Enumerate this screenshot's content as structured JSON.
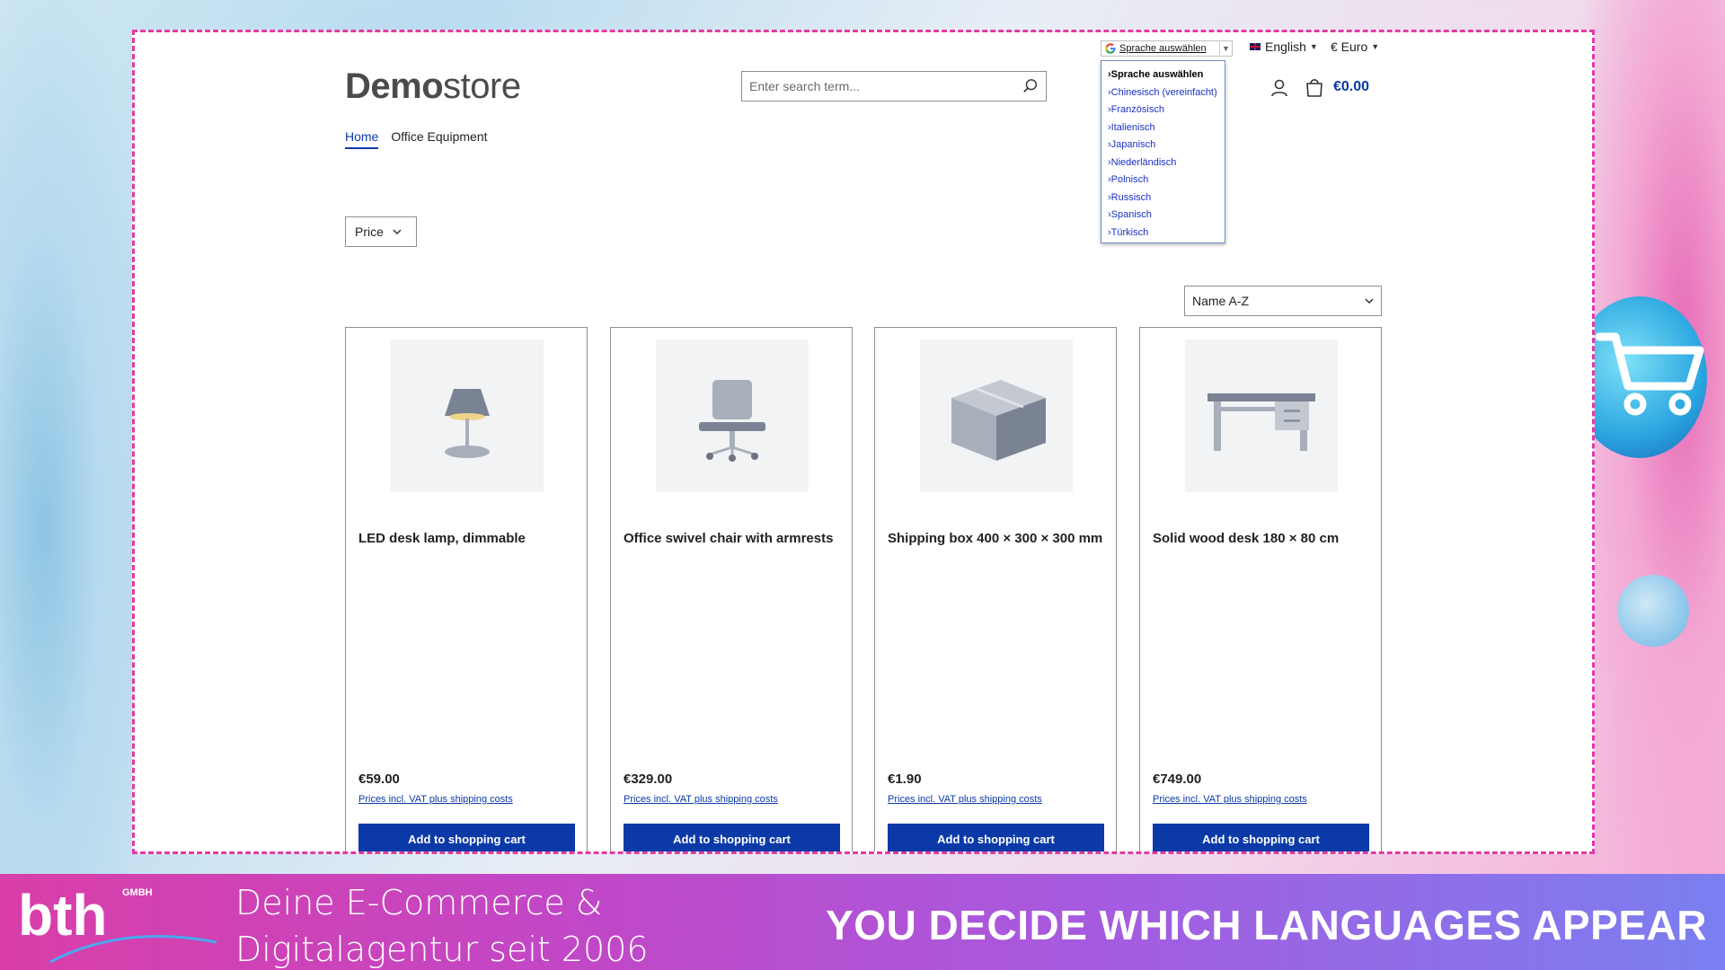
{
  "store": {
    "logo_bold": "Demo",
    "logo_light": "store",
    "search_placeholder": "Enter search term...",
    "language": "English",
    "currency": "€ Euro",
    "cart_total": "€0.00"
  },
  "translate": {
    "label": "Sprache auswählen",
    "options": [
      "›Sprache auswählen",
      "›Chinesisch (vereinfacht)",
      "›Französisch",
      "›Italienisch",
      "›Japanisch",
      "›Niederländisch",
      "›Polnisch",
      "›Russisch",
      "›Spanisch",
      "›Türkisch"
    ]
  },
  "nav": {
    "items": [
      "Home",
      "Office Equipment"
    ]
  },
  "filters": {
    "price_label": "Price",
    "sort_label": "Name A-Z"
  },
  "products": [
    {
      "name": "LED desk lamp, dimmable",
      "price": "€59.00",
      "vat": "Prices incl. VAT plus shipping costs",
      "button": "Add to shopping cart",
      "icon": "lamp-icon"
    },
    {
      "name": "Office swivel chair with armrests",
      "price": "€329.00",
      "vat": "Prices incl. VAT plus shipping costs",
      "button": "Add to shopping cart",
      "icon": "chair-icon"
    },
    {
      "name": "Shipping box 400 × 300 × 300 mm",
      "price": "€1.90",
      "vat": "Prices incl. VAT plus shipping costs",
      "button": "Add to shopping cart",
      "icon": "box-icon"
    },
    {
      "name": "Solid wood desk 180 × 80 cm",
      "price": "€749.00",
      "vat": "Prices incl. VAT plus shipping costs",
      "button": "Add to shopping cart",
      "icon": "desk-icon"
    }
  ],
  "banner": {
    "brand": "bth",
    "brand_suffix": "GMBH",
    "tagline_line1": "Deine E-Commerce &",
    "tagline_line2": "Digitalagentur seit 2006",
    "headline": "YOU DECIDE WHICH LANGUAGES APPEAR"
  },
  "colors": {
    "accent": "#0b3aa8",
    "frame": "#e23aa4",
    "banner_start": "#d93ea8",
    "banner_end": "#7a7ff0"
  }
}
